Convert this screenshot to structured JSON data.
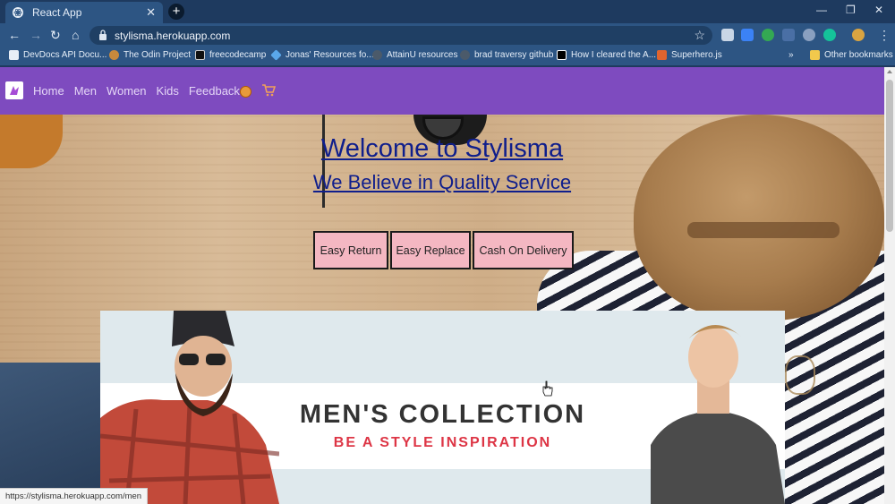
{
  "browser": {
    "tab_title": "React App",
    "url": "stylisma.herokuapp.com",
    "bookmarks": [
      "DevDocs API Docu...",
      "The Odin Project",
      "freecodecamp",
      "Jonas' Resources fo...",
      "AttainU resources",
      "brad traversy github",
      "How I cleared the A...",
      "Superhero.js"
    ],
    "other_bookmarks": "Other bookmarks",
    "status_url": "https://stylisma.herokuapp.com/men"
  },
  "nav": {
    "links": [
      "Home",
      "Men",
      "Women",
      "Kids",
      "Feedback"
    ]
  },
  "hero": {
    "title": "Welcome to Stylisma",
    "subtitle": "We Believe in Quality Service"
  },
  "features": [
    "Easy Return",
    "Easy Replace",
    "Cash On Delivery"
  ],
  "banner": {
    "title": "MEN'S COLLECTION",
    "subtitle": "BE A STYLE INSPIRATION"
  },
  "colors": {
    "nav_bg": "#7e4bbf",
    "heading": "#0f1e8c",
    "feature_bg": "#f4b7c2",
    "banner_accent": "#dd3545"
  }
}
